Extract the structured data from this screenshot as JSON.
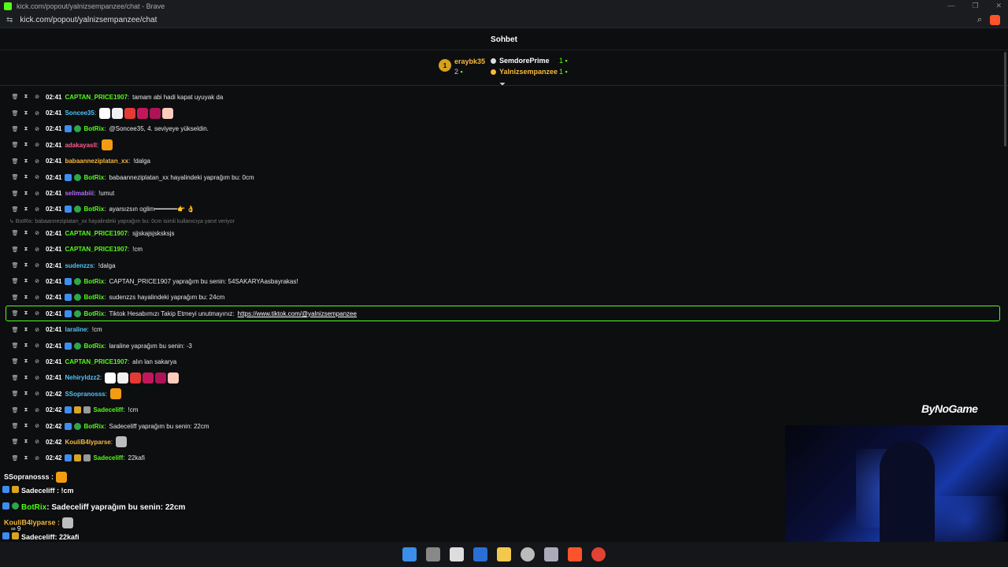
{
  "window": {
    "title": "kick.com/popout/yalnizsempanzee/chat - Brave",
    "url": "kick.com/popout/yalnizsempanzee/chat"
  },
  "chat": {
    "title": "Sohbet",
    "pinned": {
      "top_user": "eraybk35",
      "top_count": "2",
      "rank2_user": "SemdorePrime",
      "rank2_count": "1",
      "rank3_user": "Yalnizsempanzee",
      "rank3_count": "1"
    },
    "messages": [
      {
        "time": "02:41",
        "user": "CAPTAN_PRICE1907",
        "color": "#53fc18",
        "text": "tamam abi hadi kapat uyuyak da",
        "badges": []
      },
      {
        "time": "02:41",
        "user": "Soncee35",
        "color": "#4fc3f7",
        "text": "",
        "badges": [],
        "emotes": [
          "#ffffff",
          "#f0f0f0",
          "#e53935",
          "#c2185b",
          "#ad1457",
          "#ffccbc"
        ]
      },
      {
        "time": "02:41",
        "user": "BotRix",
        "color": "#53fc18",
        "text": "@Soncee35, 4. seviyeye yükseldin.",
        "badges": [
          "blue",
          "green"
        ]
      },
      {
        "time": "02:41",
        "user": "adakayasll",
        "color": "#ff5c8a",
        "text": "",
        "badges": [],
        "emotes": [
          "#f39c12"
        ]
      },
      {
        "time": "02:41",
        "user": "babaanneziplatan_xx",
        "color": "#f6b93b",
        "text": "!dalga",
        "badges": []
      },
      {
        "time": "02:41",
        "user": "BotRix",
        "color": "#53fc18",
        "text": "babaanneziplatan_xx hayalindeki yaprağım bu: 0cm",
        "badges": [
          "blue",
          "green"
        ]
      },
      {
        "time": "02:41",
        "user": "selimabiii",
        "color": "#b36bff",
        "text": "!umut",
        "badges": []
      },
      {
        "time": "02:41",
        "user": "BotRix",
        "color": "#53fc18",
        "text": "ayarsızsın oglim━━━━━━👉 👌",
        "badges": [
          "blue",
          "green"
        ]
      }
    ],
    "reply_note": "BotRix: babaanneziplatan_xx hayalindeki yaprağım bu: 0cm isimli kullanıcıya yanıt veriyor",
    "messages2": [
      {
        "time": "02:41",
        "user": "CAPTAN_PRICE1907",
        "color": "#53fc18",
        "text": "sjjskajsjsksksjs",
        "badges": []
      },
      {
        "time": "02:41",
        "user": "CAPTAN_PRICE1907",
        "color": "#53fc18",
        "text": "!cm",
        "badges": []
      },
      {
        "time": "02:41",
        "user": "sudenzzs",
        "color": "#4fc3f7",
        "text": "!dalga",
        "badges": []
      },
      {
        "time": "02:41",
        "user": "BotRix",
        "color": "#53fc18",
        "text": "CAPTAN_PRICE1907 yaprağım bu senin: 54SAKARYAasbayrakas!",
        "badges": [
          "blue",
          "green"
        ]
      },
      {
        "time": "02:41",
        "user": "BotRix",
        "color": "#53fc18",
        "text": "sudenzzs hayalindeki yaprağım bu: 24cm",
        "badges": [
          "blue",
          "green"
        ]
      }
    ],
    "highlight": {
      "time": "02:41",
      "user": "BotRix",
      "color": "#53fc18",
      "text": "Tiktok Hesabımızı Takip Etmeyi unutmayınız:",
      "link": "https://www.tiktok.com/@yalnizsempanzee"
    },
    "messages3": [
      {
        "time": "02:41",
        "user": "laraline",
        "color": "#4fc3f7",
        "text": "!cm",
        "badges": []
      },
      {
        "time": "02:41",
        "user": "BotRix",
        "color": "#53fc18",
        "text": "laraline yaprağım bu senin: -3",
        "badges": [
          "blue",
          "green"
        ]
      },
      {
        "time": "02:41",
        "user": "CAPTAN_PRICE1907",
        "color": "#53fc18",
        "text": "alın lan sakarya",
        "badges": []
      },
      {
        "time": "02:41",
        "user": "Nehiryldzz2",
        "color": "#4fc3f7",
        "text": "",
        "badges": [],
        "emotes": [
          "#ffffff",
          "#f0f0f0",
          "#e53935",
          "#c2185b",
          "#ad1457",
          "#ffccbc"
        ]
      },
      {
        "time": "02:42",
        "user": "SSopranosss",
        "color": "#4fc3f7",
        "text": "",
        "badges": [],
        "emotes": [
          "#f39c12"
        ]
      },
      {
        "time": "02:42",
        "user": "Sadeceliff",
        "color": "#53fc18",
        "text": "!cm",
        "badges": [
          "blue",
          "gold",
          "gray"
        ]
      },
      {
        "time": "02:42",
        "user": "BotRix",
        "color": "#53fc18",
        "text": "Sadeceliff yaprağım bu senin: 22cm",
        "badges": [
          "blue",
          "green"
        ]
      },
      {
        "time": "02:42",
        "user": "KouliB4lyparse",
        "color": "#f6b93b",
        "text": "",
        "badges": [],
        "emotes": [
          "#bdbdbd"
        ]
      },
      {
        "time": "02:42",
        "user": "Sadeceliff",
        "color": "#53fc18",
        "text": "22kafi",
        "badges": [
          "blue",
          "gold",
          "gray"
        ]
      }
    ]
  },
  "overlay": {
    "l1_user": "SSopranosss :",
    "l2_user": "Sadeceliff : !cm",
    "l3_user": "BotRix",
    "l3_text": ": Sadeceliff yaprağım bu senin: 22cm",
    "l4_user": "KouliB4lyparse :",
    "l4_sub": "∞  9",
    "l5_user": "Sadeceliff",
    "l5_text": ": 22kafi"
  },
  "watermark": "ByNoGame",
  "taskbar": [
    "windows-icon",
    "task-view-icon",
    "app-icon",
    "store-icon",
    "explorer-icon",
    "obs-icon",
    "steam-icon",
    "brave-icon",
    "chrome-icon"
  ]
}
